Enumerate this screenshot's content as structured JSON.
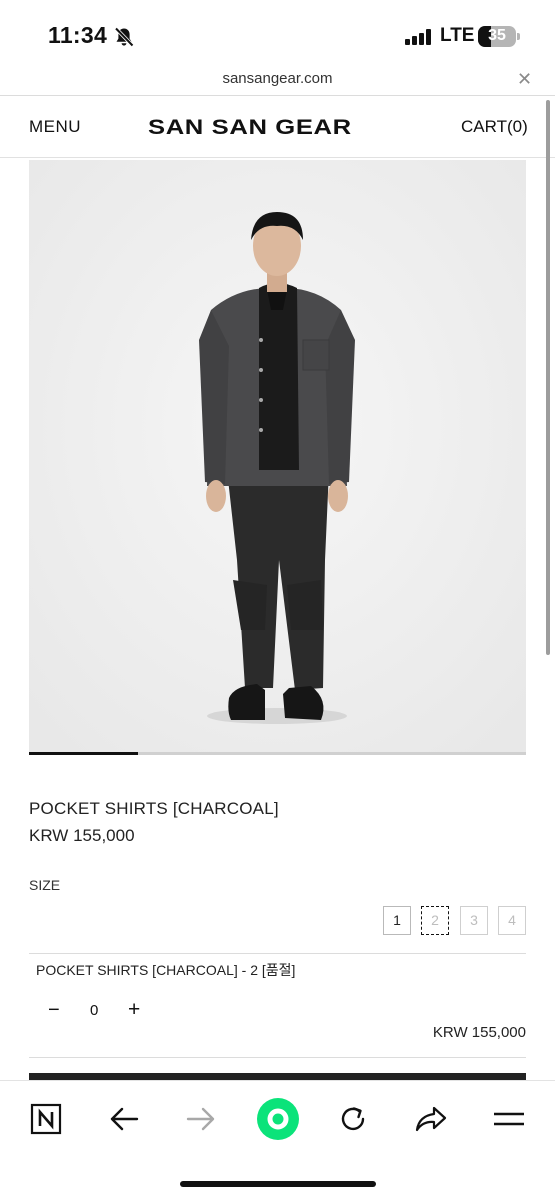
{
  "status_bar": {
    "time": "11:34",
    "network": "LTE",
    "battery": "35",
    "icons": [
      "bell-slash-icon",
      "cellular-signal-icon",
      "battery-icon"
    ]
  },
  "url_bar": {
    "url": "sansangear.com",
    "close_icon": "close-icon"
  },
  "header": {
    "menu_label": "MENU",
    "logo": "SAN SAN GEAR",
    "cart_label": "CART(0)"
  },
  "gallery": {
    "image_icon": "product-photo",
    "progress_fraction": 0.22
  },
  "product": {
    "name": "POCKET SHIRTS [CHARCOAL]",
    "price": "KRW 155,000",
    "size_label": "SIZE",
    "sizes": [
      {
        "label": "1",
        "available": true,
        "selected": false
      },
      {
        "label": "2",
        "available": false,
        "selected": true
      },
      {
        "label": "3",
        "available": false,
        "selected": false
      },
      {
        "label": "4",
        "available": false,
        "selected": false
      }
    ]
  },
  "selection": {
    "item_text": "POCKET SHIRTS [CHARCOAL] - 2 [품절]",
    "minus": "−",
    "quantity": "0",
    "plus": "+",
    "line_price": "KRW 155,000"
  },
  "toolbar": {
    "icons": [
      "naver-n-icon",
      "back-arrow-icon",
      "forward-arrow-icon",
      "green-dot-icon",
      "reload-icon",
      "share-icon",
      "hamburger-menu-icon"
    ],
    "accent_color": "#0be37a"
  }
}
